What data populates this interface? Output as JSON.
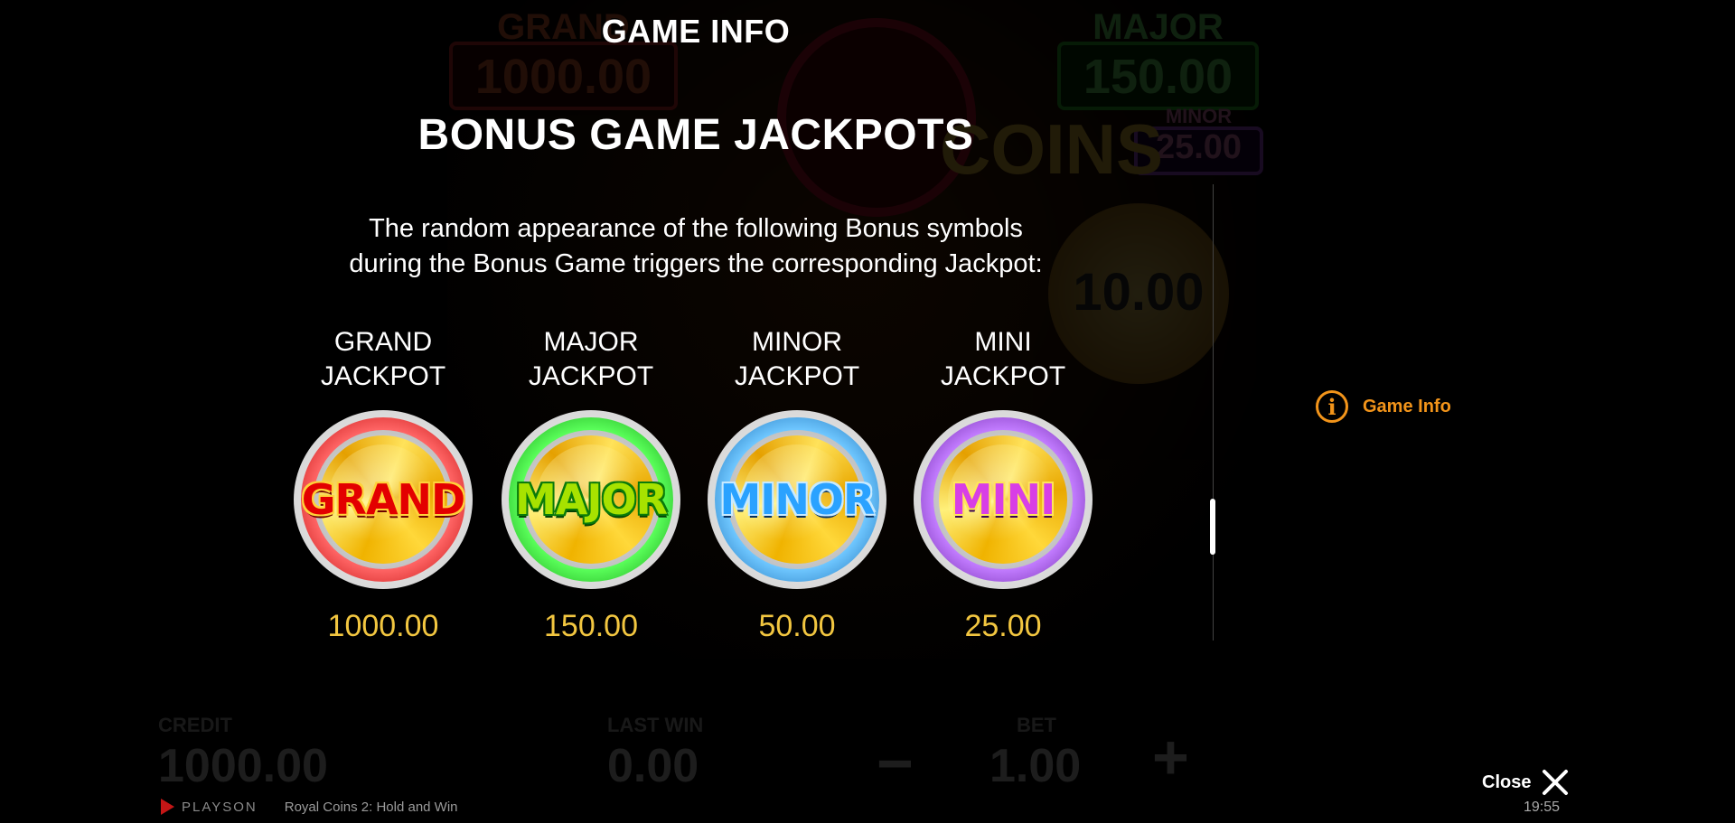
{
  "background": {
    "grand_label": "GRAND",
    "grand_value": "1000.00",
    "major_label": "MAJOR",
    "major_value": "150.00",
    "minor_label": "MINOR",
    "minor_value": "25.00",
    "coins_text": "COINS",
    "coin_value": "10.00",
    "credit_label": "CREDIT",
    "credit_value": "1000.00",
    "last_win_label": "LAST WIN",
    "last_win_value": "0.00",
    "bet_label": "BET",
    "bet_value": "1.00",
    "minus_symbol": "−",
    "plus_symbol": "+"
  },
  "panel": {
    "title": "GAME INFO",
    "heading": "BONUS GAME JACKPOTS",
    "desc_line1": "The random appearance of the following Bonus symbols",
    "desc_line2": "during the Bonus Game triggers the corresponding Jackpot:"
  },
  "jackpots": [
    {
      "name_line1": "GRAND",
      "name_line2": "JACKPOT",
      "symbol": "GRAND",
      "value": "1000.00",
      "ring_color": "#d00000"
    },
    {
      "name_line1": "MAJOR",
      "name_line2": "JACKPOT",
      "symbol": "MAJOR",
      "value": "150.00",
      "ring_color": "#119c11"
    },
    {
      "name_line1": "MINOR",
      "name_line2": "JACKPOT",
      "symbol": "MINOR",
      "value": "50.00",
      "ring_color": "#1a72c2"
    },
    {
      "name_line1": "MINI",
      "name_line2": "JACKPOT",
      "symbol": "MINI",
      "value": "25.00",
      "ring_color": "#6e22a8"
    }
  ],
  "nav": {
    "game_info_label": "Game Info",
    "icon": "info-icon",
    "accent_color": "#f2941a"
  },
  "controls": {
    "close_label": "Close",
    "time": "19:55"
  },
  "footer": {
    "brand": "PLAYSON",
    "game_name": "Royal Coins 2: Hold and Win"
  }
}
